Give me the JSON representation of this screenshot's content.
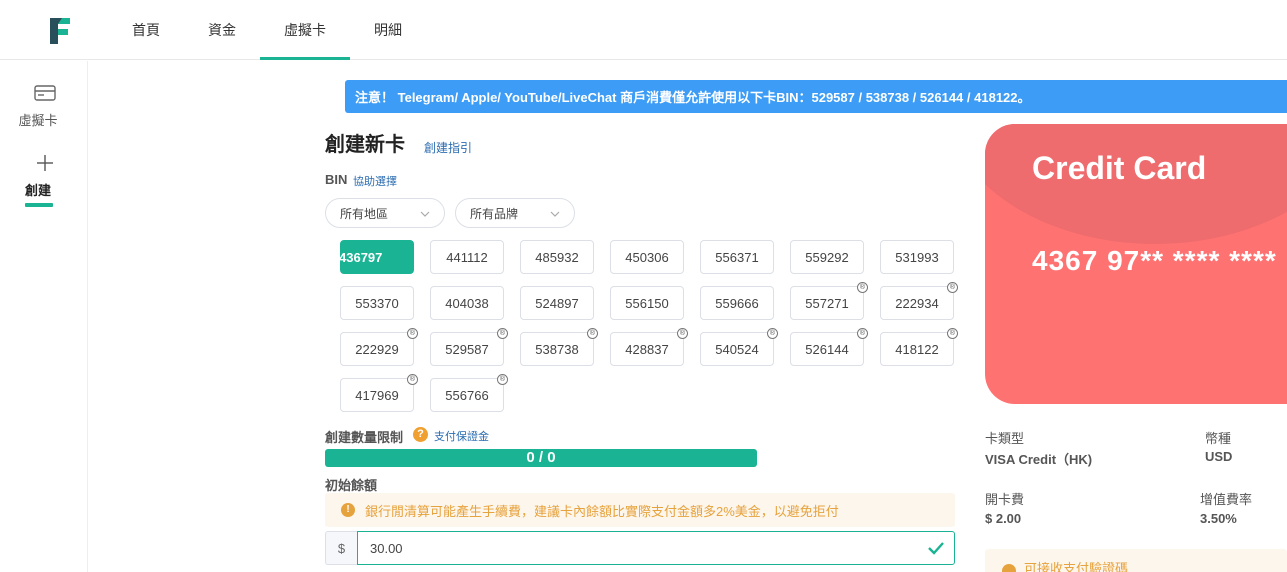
{
  "nav": {
    "items": [
      {
        "label": "首頁"
      },
      {
        "label": "資金"
      },
      {
        "label": "虛擬卡",
        "active": true
      },
      {
        "label": "明細"
      }
    ]
  },
  "sidebar": {
    "items": [
      {
        "label": "虛擬卡",
        "icon": "credit-card-icon"
      },
      {
        "label": "創建",
        "icon": "plus-icon",
        "active": true
      }
    ]
  },
  "notice": "注意！ Telegram/ Apple/ YouTube/LiveChat 商戶消費僅允許使用以下卡BIN：529587 / 538738 / 526144 / 418122。",
  "create": {
    "title": "創建新卡",
    "guide_link": "創建指引",
    "bin_label": "BIN",
    "bin_help": "協助選擇",
    "filter_region": "所有地區",
    "filter_brand": "所有品牌",
    "bins": [
      {
        "value": "436797",
        "active": true,
        "badge": false
      },
      {
        "value": "441112",
        "badge": false
      },
      {
        "value": "485932",
        "badge": false
      },
      {
        "value": "450306",
        "badge": false
      },
      {
        "value": "556371",
        "badge": false
      },
      {
        "value": "559292",
        "badge": false
      },
      {
        "value": "531993",
        "badge": false
      },
      {
        "value": "553370",
        "badge": false
      },
      {
        "value": "404038",
        "badge": false
      },
      {
        "value": "524897",
        "badge": false
      },
      {
        "value": "556150",
        "badge": false
      },
      {
        "value": "559666",
        "badge": false
      },
      {
        "value": "557271",
        "badge": true
      },
      {
        "value": "222934",
        "badge": true
      },
      {
        "value": "222929",
        "badge": true
      },
      {
        "value": "529587",
        "badge": true
      },
      {
        "value": "538738",
        "badge": true
      },
      {
        "value": "428837",
        "badge": true
      },
      {
        "value": "540524",
        "badge": true
      },
      {
        "value": "526144",
        "badge": true
      },
      {
        "value": "418122",
        "badge": true
      },
      {
        "value": "417969",
        "badge": true
      },
      {
        "value": "556766",
        "badge": true
      }
    ],
    "limit_label": "創建數量限制",
    "deposit_link": "支付保證金",
    "progress_text": "0 / 0",
    "initial_label": "初始餘額",
    "warning": "銀行閒清算可能產生手續費，建議卡內餘額比實際支付金額多2%美金，以避免拒付",
    "currency_symbol": "$",
    "amount": "30.00"
  },
  "card_preview": {
    "title": "Credit Card",
    "number": "4367 97** **** ****",
    "color": "#ff7272"
  },
  "info": {
    "type_label": "卡類型",
    "type_value": "VISA Credit（HK)",
    "currency_label": "幣種",
    "currency_value": "USD",
    "fee_label": "開卡費",
    "fee_value": "$ 2.00",
    "rate_label": "增值費率",
    "rate_value": "3.50%"
  },
  "verify_text": "可接收支付驗證碼",
  "colors": {
    "accent": "#1ab394",
    "notice_bg": "#3d9cf5",
    "warning": "#e6a23c",
    "link": "#2b6cb0"
  }
}
